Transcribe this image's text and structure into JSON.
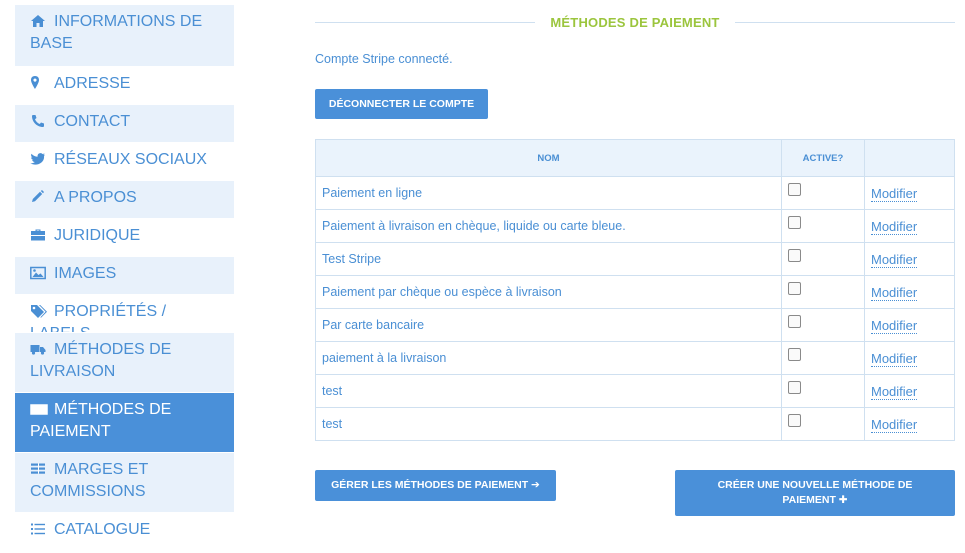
{
  "sidebar": {
    "items": [
      {
        "label": "INFORMATIONS DE BASE",
        "icon": "home-icon"
      },
      {
        "label": "ADRESSE",
        "icon": "map-marker-icon"
      },
      {
        "label": "CONTACT",
        "icon": "phone-icon"
      },
      {
        "label": "RÉSEAUX SOCIAUX",
        "icon": "twitter-icon"
      },
      {
        "label": "A PROPOS",
        "icon": "pencil-icon"
      },
      {
        "label": "JURIDIQUE",
        "icon": "briefcase-icon"
      },
      {
        "label": "IMAGES",
        "icon": "image-icon"
      },
      {
        "label": "PROPRIÉTÉS / LABELS",
        "icon": "tags-icon"
      },
      {
        "label": "MÉTHODES DE LIVRAISON",
        "icon": "truck-icon"
      },
      {
        "label": "MÉTHODES DE PAIEMENT",
        "icon": "money-icon"
      },
      {
        "label": "MARGES ET COMMISSIONS",
        "icon": "tasks-icon"
      },
      {
        "label": "CATALOGUE",
        "icon": "list-icon"
      }
    ]
  },
  "main": {
    "section_title": "MÉTHODES DE PAIEMENT",
    "status": "Compte Stripe connecté.",
    "disconnect_label": "DÉCONNECTER LE COMPTE",
    "table": {
      "headers": [
        "NOM",
        "ACTIVE?",
        ""
      ],
      "rows": [
        {
          "name": "Paiement en ligne",
          "active": false,
          "action": "Modifier"
        },
        {
          "name": "Paiement à livraison en chèque, liquide ou carte bleue.",
          "active": false,
          "action": "Modifier"
        },
        {
          "name": "Test Stripe",
          "active": false,
          "action": "Modifier"
        },
        {
          "name": "Paiement par chèque ou espèce à livraison",
          "active": false,
          "action": "Modifier"
        },
        {
          "name": "Par carte bancaire",
          "active": false,
          "action": "Modifier"
        },
        {
          "name": "paiement à la livraison",
          "active": false,
          "action": "Modifier"
        },
        {
          "name": "test",
          "active": false,
          "action": "Modifier"
        },
        {
          "name": "test",
          "active": false,
          "action": "Modifier"
        }
      ]
    },
    "manage_label": "GÉRER LES MÉTHODES DE PAIEMENT ➔",
    "create_label": "CRÉER UNE NOUVELLE MÉTHODE DE PAIEMENT ✚"
  },
  "colors": {
    "accent": "#4a90d9",
    "section_title": "#9bc53d",
    "sidebar_alt_bg": "#e8f1fb"
  }
}
